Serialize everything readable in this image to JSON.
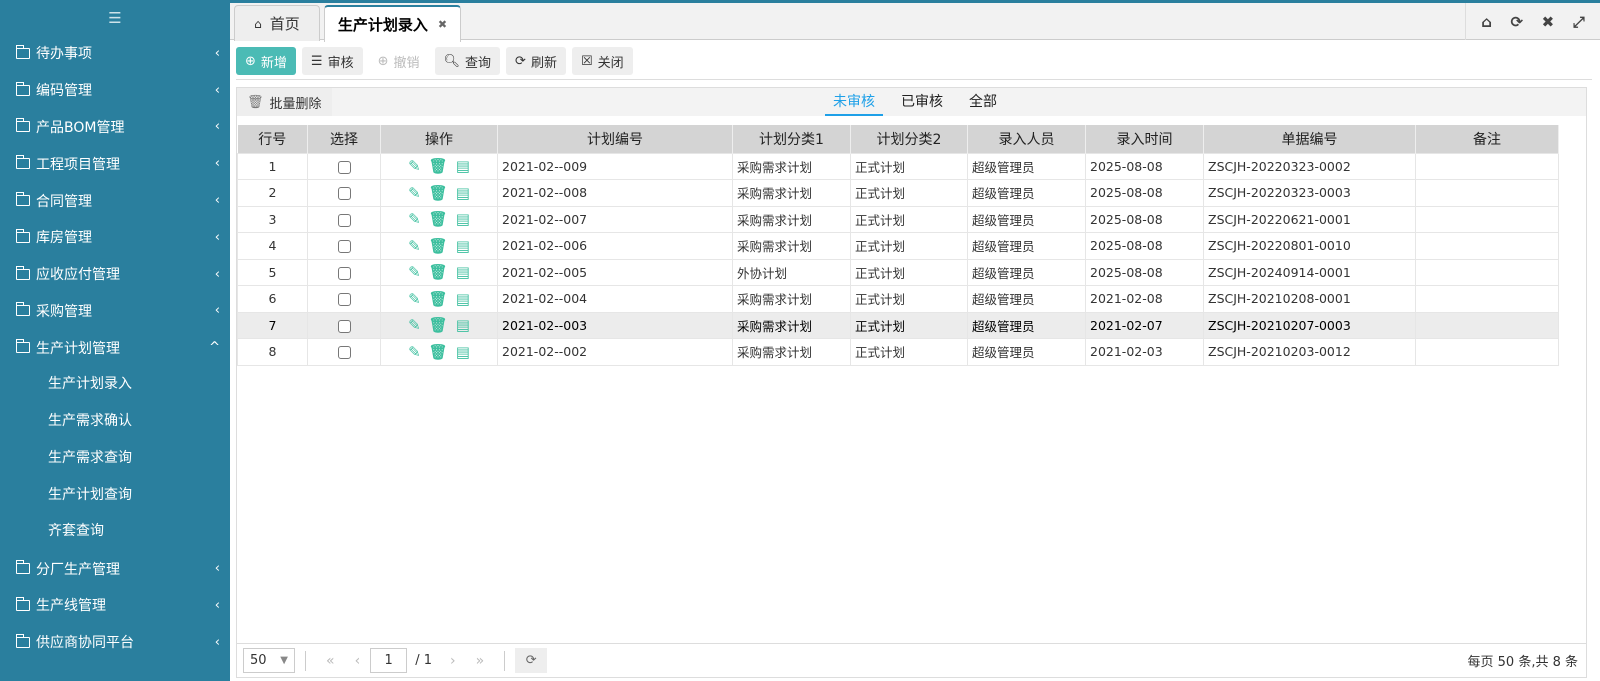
{
  "sidebar": {
    "items": [
      {
        "label": "待办事项",
        "expanded": false
      },
      {
        "label": "编码管理",
        "expanded": false
      },
      {
        "label": "产品BOM管理",
        "expanded": false
      },
      {
        "label": "工程项目管理",
        "expanded": false
      },
      {
        "label": "合同管理",
        "expanded": false
      },
      {
        "label": "库房管理",
        "expanded": false
      },
      {
        "label": "应收应付管理",
        "expanded": false
      },
      {
        "label": "采购管理",
        "expanded": false
      },
      {
        "label": "生产计划管理",
        "expanded": true
      }
    ],
    "sub_items": [
      "生产计划录入",
      "生产需求确认",
      "生产需求查询",
      "生产计划查询",
      "齐套查询"
    ],
    "items_after": [
      {
        "label": "分厂生产管理"
      },
      {
        "label": "生产线管理"
      },
      {
        "label": "供应商协同平台"
      }
    ]
  },
  "tabs": [
    {
      "label": "首页"
    },
    {
      "label": "生产计划录入",
      "active": true
    }
  ],
  "toolbar": {
    "add": "新增",
    "audit": "审核",
    "revoke": "撤销",
    "query": "查询",
    "refresh": "刷新",
    "close": "关闭"
  },
  "panel": {
    "batch_delete": "批量删除",
    "subtabs": [
      "未审核",
      "已审核",
      "全部"
    ]
  },
  "table": {
    "headers": [
      "行号",
      "选择",
      "操作",
      "计划编号",
      "计划分类1",
      "计划分类2",
      "录入人员",
      "录入时间",
      "单据编号",
      "备注"
    ],
    "rows": [
      [
        "1",
        "2021-02--009",
        "采购需求计划",
        "正式计划",
        "超级管理员",
        "2025-08-08",
        "ZSCJH-20220323-0002",
        ""
      ],
      [
        "2",
        "2021-02--008",
        "采购需求计划",
        "正式计划",
        "超级管理员",
        "2025-08-08",
        "ZSCJH-20220323-0003",
        ""
      ],
      [
        "3",
        "2021-02--007",
        "采购需求计划",
        "正式计划",
        "超级管理员",
        "2025-08-08",
        "ZSCJH-20220621-0001",
        ""
      ],
      [
        "4",
        "2021-02--006",
        "采购需求计划",
        "正式计划",
        "超级管理员",
        "2025-08-08",
        "ZSCJH-20220801-0010",
        ""
      ],
      [
        "5",
        "2021-02--005",
        "外协计划",
        "正式计划",
        "超级管理员",
        "2025-08-08",
        "ZSCJH-20240914-0001",
        ""
      ],
      [
        "6",
        "2021-02--004",
        "采购需求计划",
        "正式计划",
        "超级管理员",
        "2021-02-08",
        "ZSCJH-20210208-0001",
        ""
      ],
      [
        "7",
        "2021-02--003",
        "采购需求计划",
        "正式计划",
        "超级管理员",
        "2021-02-07",
        "ZSCJH-20210207-0003",
        ""
      ],
      [
        "8",
        "2021-02--002",
        "采购需求计划",
        "正式计划",
        "超级管理员",
        "2021-02-03",
        "ZSCJH-20210203-0012",
        ""
      ]
    ],
    "highlighted_row": 7
  },
  "pager": {
    "page_size": "50",
    "page": "1",
    "total_pages": "/ 1",
    "info": "每页 50 条,共 8 条"
  },
  "colors": {
    "sidebar": "#2a7f9e",
    "primary": "#4bbbb5",
    "active_subtab": "#1ea0e8",
    "icon": "#3cbf9e"
  }
}
